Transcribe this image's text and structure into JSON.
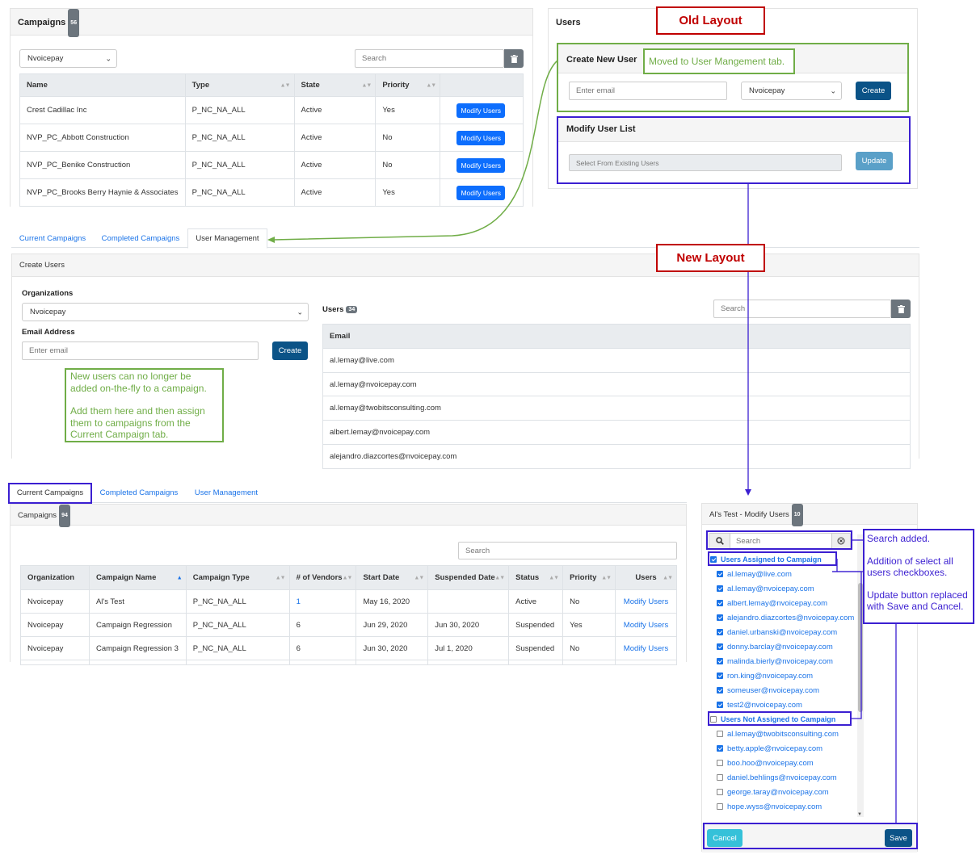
{
  "old_campaigns": {
    "title": "Campaigns",
    "count": "56",
    "org_select": "Nvoicepay",
    "search_placeholder": "Search",
    "columns": [
      "Name",
      "Type",
      "State",
      "Priority"
    ],
    "rows": [
      {
        "name": "Crest Cadillac Inc",
        "type": "P_NC_NA_ALL",
        "state": "Active",
        "priority": "Yes",
        "action": "Modify Users"
      },
      {
        "name": "NVP_PC_Abbott Construction",
        "type": "P_NC_NA_ALL",
        "state": "Active",
        "priority": "No",
        "action": "Modify Users"
      },
      {
        "name": "NVP_PC_Benike Construction",
        "type": "P_NC_NA_ALL",
        "state": "Active",
        "priority": "No",
        "action": "Modify Users"
      },
      {
        "name": "NVP_PC_Brooks Berry Haynie & Associates",
        "type": "P_NC_NA_ALL",
        "state": "Active",
        "priority": "Yes",
        "action": "Modify Users"
      }
    ]
  },
  "old_users": {
    "title": "Users",
    "create_title": "Create New User",
    "email_placeholder": "Enter email",
    "org_select": "Nvoicepay",
    "create_label": "Create",
    "modify_title": "Modify User List",
    "select_placeholder": "Select From Existing Users",
    "update_label": "Update"
  },
  "callouts": {
    "old_layout": "Old Layout",
    "new_layout": "New Layout",
    "moved_note": "Moved to User Mangement tab.",
    "new_users_note_1": "New users can no longer be added on-the-fly to a campaign.",
    "new_users_note_2": "Add them here and then assign them to campaigns from the Current Campaign tab.",
    "right_note_1": "Search added.",
    "right_note_2": "Addition of select all users checkboxes.",
    "right_note_3": "Update button replaced with Save and Cancel."
  },
  "user_mgmt": {
    "tabs": [
      "Current Campaigns",
      "Completed Campaigns",
      "User Management"
    ],
    "section_title": "Create Users",
    "org_label": "Organizations",
    "org_select": "Nvoicepay",
    "email_label": "Email Address",
    "email_placeholder": "Enter email",
    "create_label": "Create",
    "users_title": "Users",
    "users_count": "34",
    "search_placeholder": "Search",
    "email_header": "Email",
    "emails": [
      "al.lemay@live.com",
      "al.lemay@nvoicepay.com",
      "al.lemay@twobitsconsulting.com",
      "albert.lemay@nvoicepay.com",
      "alejandro.diazcortes@nvoicepay.com"
    ]
  },
  "new_campaigns": {
    "tabs": [
      "Current Campaigns",
      "Completed Campaigns",
      "User Management"
    ],
    "title": "Campaigns",
    "count": "94",
    "search_placeholder": "Search",
    "columns": [
      "Organization",
      "Campaign Name",
      "Campaign Type",
      "# of Vendors",
      "Start Date",
      "Suspended Date",
      "Status",
      "Priority",
      "Users"
    ],
    "rows": [
      {
        "org": "Nvoicepay",
        "name": "Al's Test",
        "type": "P_NC_NA_ALL",
        "vendors": "1",
        "start": "May 16, 2020",
        "suspended": "",
        "status": "Active",
        "priority": "No",
        "users": "Modify Users"
      },
      {
        "org": "Nvoicepay",
        "name": "Campaign Regression",
        "type": "P_NC_NA_ALL",
        "vendors": "6",
        "start": "Jun 29, 2020",
        "suspended": "Jun 30, 2020",
        "status": "Suspended",
        "priority": "Yes",
        "users": "Modify Users"
      },
      {
        "org": "Nvoicepay",
        "name": "Campaign Regression 3",
        "type": "P_NC_NA_ALL",
        "vendors": "6",
        "start": "Jun 30, 2020",
        "suspended": "Jul 1, 2020",
        "status": "Suspended",
        "priority": "No",
        "users": "Modify Users"
      }
    ]
  },
  "modify_panel": {
    "title": "Al's Test - Modify Users",
    "count": "10",
    "search_placeholder": "Search",
    "assigned_label": "Users Assigned to Campaign",
    "assigned": [
      "al.lemay@live.com",
      "al.lemay@nvoicepay.com",
      "albert.lemay@nvoicepay.com",
      "alejandro.diazcortes@nvoicepay.com",
      "daniel.urbanski@nvoicepay.com",
      "donny.barclay@nvoicepay.com",
      "malinda.bierly@nvoicepay.com",
      "ron.king@nvoicepay.com",
      "someuser@nvoicepay.com",
      "test2@nvoicepay.com"
    ],
    "not_assigned_label": "Users Not Assigned to Campaign",
    "not_assigned": [
      {
        "email": "al.lemay@twobitsconsulting.com",
        "checked": false
      },
      {
        "email": "betty.apple@nvoicepay.com",
        "checked": true
      },
      {
        "email": "boo.hoo@nvoicepay.com",
        "checked": false
      },
      {
        "email": "daniel.behlings@nvoicepay.com",
        "checked": false
      },
      {
        "email": "george.taray@nvoicepay.com",
        "checked": false
      },
      {
        "email": "hope.wyss@nvoicepay.com",
        "checked": false
      }
    ],
    "cancel_label": "Cancel",
    "save_label": "Save"
  },
  "colors": {
    "old_layout_red": "#c00000",
    "note_green": "#70ad47",
    "highlight_purple": "#3b1fd1",
    "button_blue": "#0d6efd",
    "button_dark": "#0b5387"
  }
}
